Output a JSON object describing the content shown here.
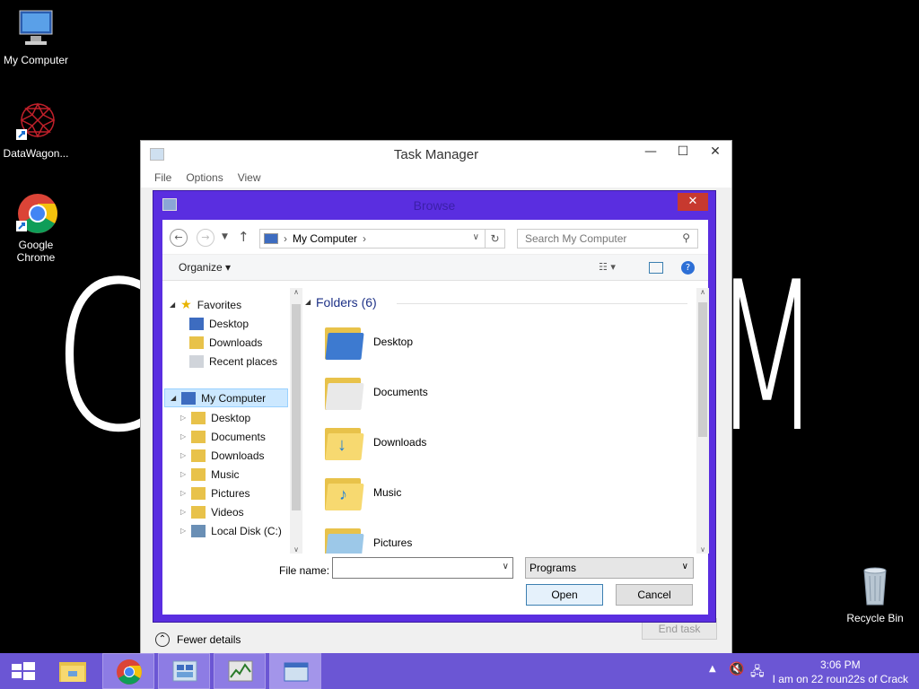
{
  "desktop": {
    "bg_letter_left": "C",
    "bg_letter_right": "M",
    "icons": [
      {
        "label": "My Computer"
      },
      {
        "label": "DataWagon..."
      },
      {
        "label": "Google Chrome"
      },
      {
        "label": "Recycle Bin"
      }
    ]
  },
  "task_manager": {
    "title": "Task Manager",
    "minimize": "—",
    "maximize": "☐",
    "close": "✕",
    "menu": [
      "File",
      "Options",
      "View"
    ],
    "fewer_details": "Fewer details",
    "end_task": "End task"
  },
  "browse": {
    "title": "Browse",
    "close": "✕",
    "address": "My Computer",
    "search_placeholder": "Search My Computer",
    "organize": "Organize ▾",
    "nav": {
      "favorites": "Favorites",
      "desktop": "Desktop",
      "downloads": "Downloads",
      "recent": "Recent places",
      "my_computer": "My Computer",
      "pc_desktop": "Desktop",
      "pc_documents": "Documents",
      "pc_downloads": "Downloads",
      "pc_music": "Music",
      "pc_pictures": "Pictures",
      "pc_videos": "Videos",
      "pc_local_disk": "Local Disk (C:)"
    },
    "group_header": "Folders (6)",
    "folders": [
      "Desktop",
      "Documents",
      "Downloads",
      "Music",
      "Pictures"
    ],
    "file_name_label": "File name:",
    "file_name_value": "",
    "file_type": "Programs",
    "open": "Open",
    "cancel": "Cancel"
  },
  "taskbar": {
    "time": "3:06 PM",
    "status": "I am on 22 roun22s of Crack"
  }
}
